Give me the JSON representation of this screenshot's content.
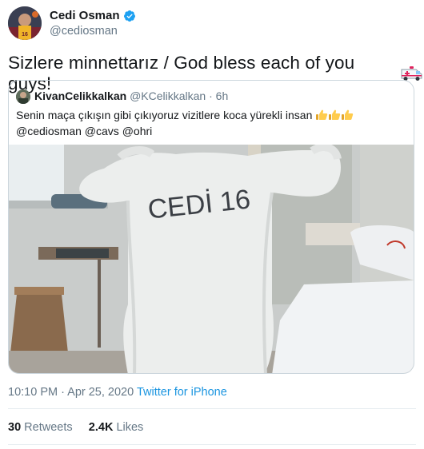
{
  "author": {
    "name": "Cedi Osman",
    "handle": "@cediosman",
    "verified": true
  },
  "tweet": {
    "text": "Sizlere minnettarız / God bless each of you guys!",
    "emoji": "ambulance-icon"
  },
  "quoted_tweet": {
    "name": "KivanCelikkalkan",
    "handle": "@KCelikkalkan",
    "time": "6h",
    "text": "Senin maça çıkışın gibi çıkıyoruz vizitlere koca yürekli insan",
    "mentions": "@cediosman @cavs @ohri",
    "photo_text": "CEDİ 16"
  },
  "meta": {
    "timestamp": "10:10 PM · Apr 25, 2020",
    "source": "Twitter for iPhone"
  },
  "stats": {
    "retweets_count": "30",
    "retweets_label": "Retweets",
    "likes_count": "2.4K",
    "likes_label": "Likes"
  },
  "colors": {
    "link": "#1b95e0",
    "secondary": "#657786",
    "border": "#ccd6dd"
  }
}
